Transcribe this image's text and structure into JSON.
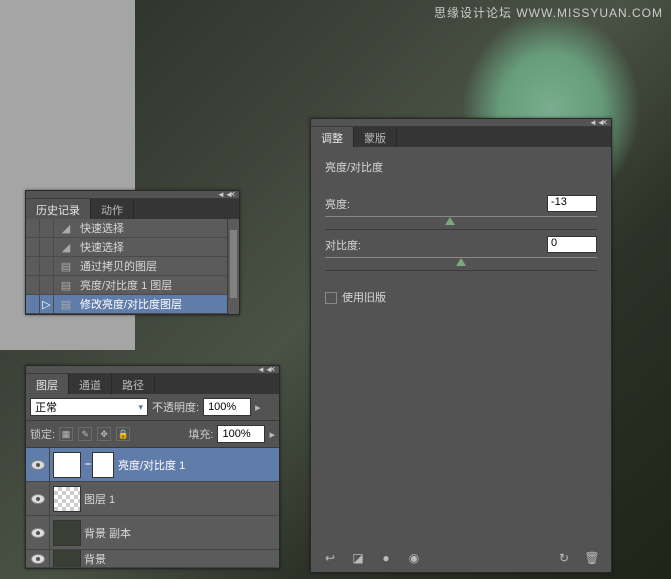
{
  "watermark": "思缘设计论坛  WWW.MISSYUAN.COM",
  "history": {
    "tabs": [
      "历史记录",
      "动作"
    ],
    "items": [
      {
        "label": "快速选择",
        "icon": "brush"
      },
      {
        "label": "快速选择",
        "icon": "brush"
      },
      {
        "label": "通过拷贝的图层",
        "icon": "layer"
      },
      {
        "label": "亮度/对比度 1 图层",
        "icon": "layer"
      },
      {
        "label": "修改亮度/对比度图层",
        "icon": "layer",
        "selected": true
      }
    ]
  },
  "layers": {
    "tabs": [
      "图层",
      "通道",
      "路径"
    ],
    "blend_mode": "正常",
    "opacity_label": "不透明度:",
    "opacity_value": "100%",
    "lock_label": "锁定:",
    "fill_label": "填充:",
    "fill_value": "100%",
    "items": [
      {
        "label": "亮度/对比度 1",
        "type": "adjust",
        "selected": true
      },
      {
        "label": "图层 1",
        "type": "checker"
      },
      {
        "label": "背景 副本",
        "type": "image"
      },
      {
        "label": "背景",
        "type": "image"
      }
    ]
  },
  "adjust": {
    "tabs": [
      "调整",
      "蒙版"
    ],
    "title": "亮度/对比度",
    "brightness_label": "亮度:",
    "brightness_value": "-13",
    "contrast_label": "对比度:",
    "contrast_value": "0",
    "legacy_label": "使用旧版"
  }
}
